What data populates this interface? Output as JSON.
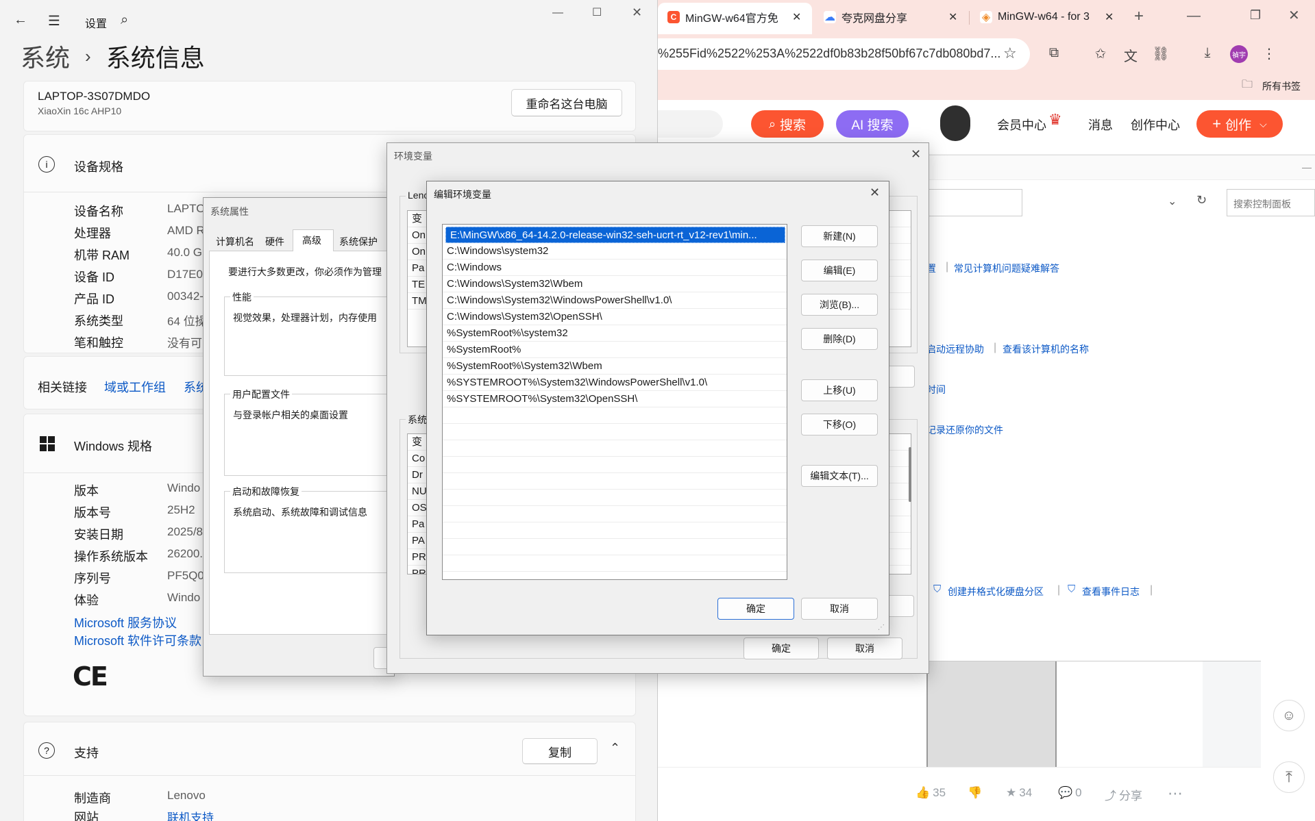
{
  "browser": {
    "tabs": [
      {
        "title": "MinGW-w64官方免",
        "icon": "csdn-icon",
        "color": "#fc5531"
      },
      {
        "title": "夸克网盘分享",
        "icon": "quark-cloud-icon",
        "color": "#3a7cf7"
      },
      {
        "title": "MinGW-w64 - for 3",
        "icon": "diamond-icon",
        "color": "#f08c2b"
      }
    ],
    "url": "%255Fid%2522%253A%2522df0b83b28f50bf67c7db080bd7...",
    "avatar_text": "禎宇",
    "bookmarks_label": "所有书签",
    "search_btn": "搜索",
    "ai_search_btn": "AI 搜索",
    "nav": [
      "会员中心",
      "消息",
      "创作中心"
    ],
    "create_btn": "创作",
    "cp_search_placeholder": "搜索控制面板",
    "cp_links": {
      "l1a": "置",
      "l1b": "常见计算机问题疑难解答",
      "l2a": "启动远程协助",
      "l2b": "查看该计算机的名称",
      "l3": "时间",
      "l4": "记录还原你的文件",
      "l5a": "创建并格式化硬盘分区",
      "l5b": "查看事件日志"
    },
    "stats": {
      "likes": "35",
      "stars": "34",
      "comments": "0",
      "share": "分享"
    }
  },
  "settings": {
    "title": "设置",
    "breadcrumb_parent": "系统",
    "breadcrumb_current": "系统信息",
    "device_name": "LAPTOP-3S07DMDO",
    "device_model": "XiaoXin 16c AHP10",
    "rename_btn": "重命名这台电脑",
    "specs_header": "设备规格",
    "specs": [
      {
        "k": "设备名称",
        "v": "LAPTO"
      },
      {
        "k": "处理器",
        "v": "AMD R"
      },
      {
        "k": "机带 RAM",
        "v": "40.0 G"
      },
      {
        "k": "设备 ID",
        "v": "D17E0"
      },
      {
        "k": "产品 ID",
        "v": "00342-"
      },
      {
        "k": "系统类型",
        "v": "64 位操"
      },
      {
        "k": "笔和触控",
        "v": "没有可"
      }
    ],
    "related_label": "相关链接",
    "related_links": [
      "域或工作组",
      "系统"
    ],
    "win_header": "Windows 规格",
    "win_specs": [
      {
        "k": "版本",
        "v": "Windo"
      },
      {
        "k": "版本号",
        "v": "25H2"
      },
      {
        "k": "安装日期",
        "v": "2025/8"
      },
      {
        "k": "操作系统版本",
        "v": "26200."
      },
      {
        "k": "序列号",
        "v": "PF5Q0"
      },
      {
        "k": "体验",
        "v": "Windo"
      }
    ],
    "ms_links": [
      "Microsoft 服务协议",
      "Microsoft 软件许可条款"
    ],
    "ce_mark": "CE",
    "support_header": "支持",
    "copy_btn": "复制",
    "support": [
      {
        "k": "制造商",
        "v": "Lenovo"
      },
      {
        "k": "网站",
        "v": "联机支持"
      }
    ]
  },
  "sysprops": {
    "title": "系统属性",
    "tabs": [
      "计算机名",
      "硬件",
      "高级",
      "系统保护"
    ],
    "intro": "要进行大多数更改，你必须作为管理",
    "perf_label": "性能",
    "perf_desc": "视觉效果，处理器计划，内存使用",
    "profile_label": "用户配置文件",
    "profile_desc": "与登录帐户相关的桌面设置",
    "startup_label": "启动和故障恢复",
    "startup_desc": "系统启动、系统故障和调试信息"
  },
  "envvars": {
    "title": "环境变量",
    "user_group": "Lenc",
    "user_rows": [
      "变",
      "On",
      "On",
      "Pa",
      "TE",
      "TM"
    ],
    "sys_group": "系统",
    "sys_rows": [
      "变",
      "Co",
      "Dr",
      "NU",
      "OS",
      "Pa",
      "PA",
      "PR",
      "PR"
    ],
    "ok": "确定",
    "cancel": "取消"
  },
  "editenv": {
    "title": "编辑环境变量",
    "entries": [
      "E:\\MinGW\\x86_64-14.2.0-release-win32-seh-ucrt-rt_v12-rev1\\min...",
      "C:\\Windows\\system32",
      "C:\\Windows",
      "C:\\Windows\\System32\\Wbem",
      "C:\\Windows\\System32\\WindowsPowerShell\\v1.0\\",
      "C:\\Windows\\System32\\OpenSSH\\",
      "%SystemRoot%\\system32",
      "%SystemRoot%",
      "%SystemRoot%\\System32\\Wbem",
      "%SYSTEMROOT%\\System32\\WindowsPowerShell\\v1.0\\",
      "%SYSTEMROOT%\\System32\\OpenSSH\\"
    ],
    "selected_index": 0,
    "buttons": {
      "new": "新建(N)",
      "edit": "编辑(E)",
      "browse": "浏览(B)...",
      "delete": "删除(D)",
      "up": "上移(U)",
      "down": "下移(O)",
      "edit_text": "编辑文本(T)..."
    },
    "ok": "确定",
    "cancel": "取消"
  }
}
